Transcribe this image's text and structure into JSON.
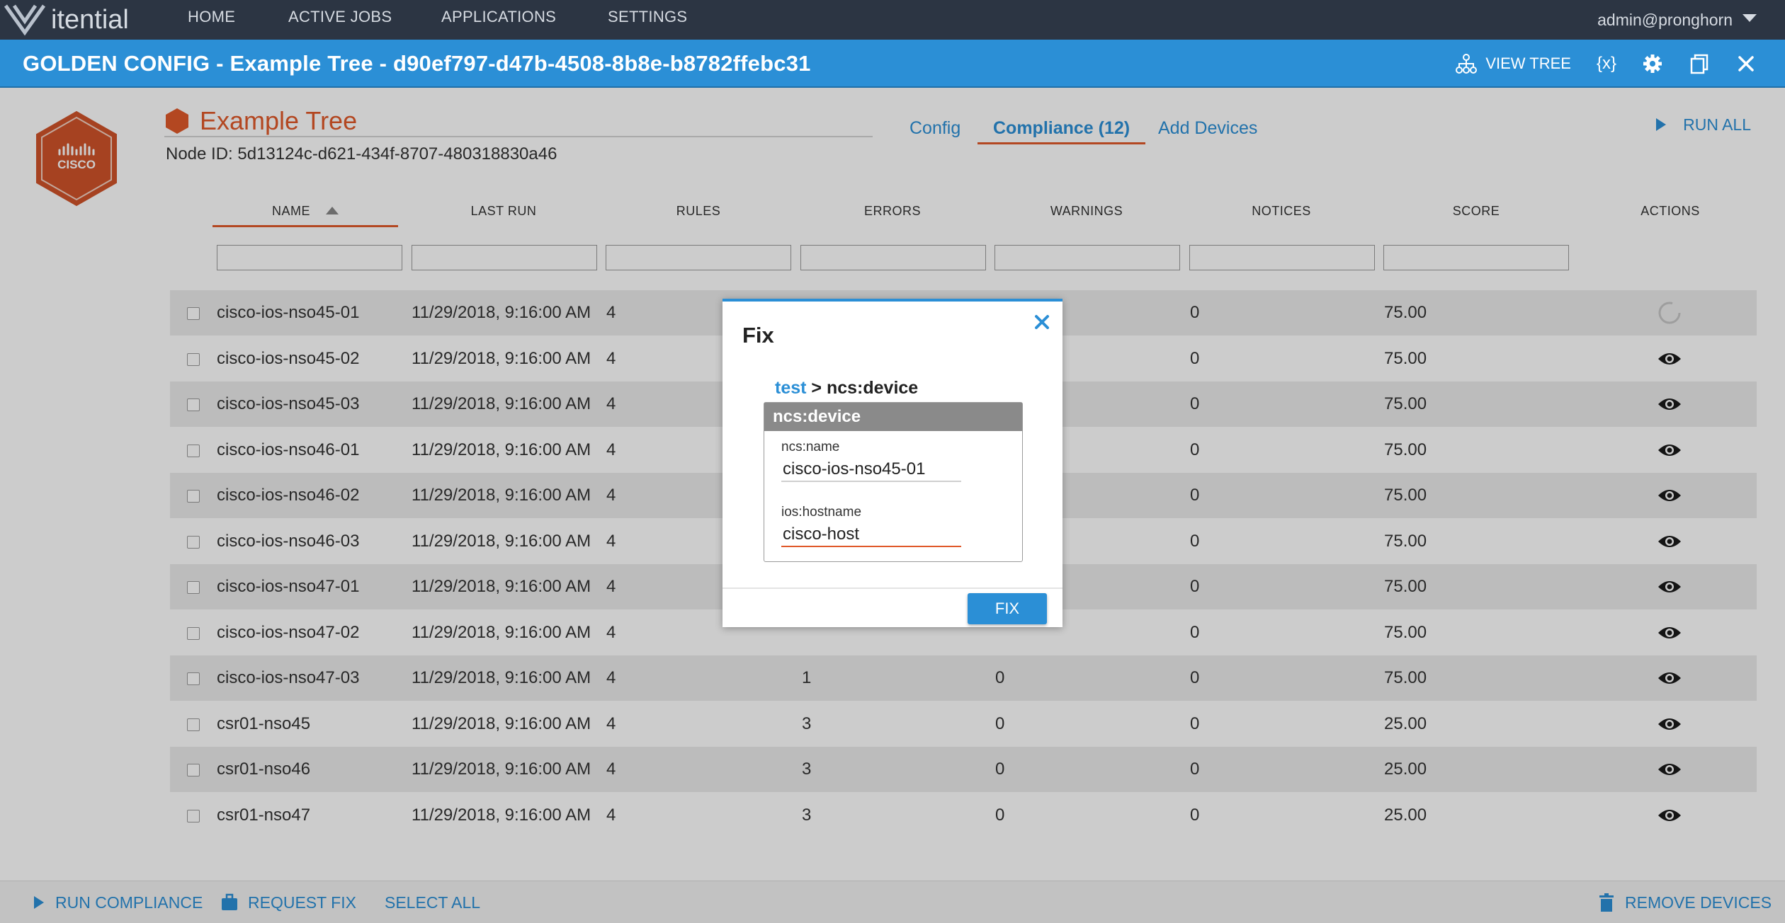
{
  "nav": {
    "brand": "itential",
    "items": [
      "HOME",
      "ACTIVE JOBS",
      "APPLICATIONS",
      "SETTINGS"
    ],
    "user": "admin@pronghorn"
  },
  "titlebar": {
    "title": "GOLDEN CONFIG - Example Tree - d90ef797-d47b-4508-8b8e-b8782ffebc31",
    "view_tree": "VIEW TREE",
    "variables": "{x}"
  },
  "node": {
    "logo_text": "CISCO",
    "name": "Example Tree",
    "id_label": "Node ID: 5d13124c-d621-434f-8707-480318830a46"
  },
  "tabs": [
    {
      "label": "Config",
      "active": false
    },
    {
      "label": "Compliance (12)",
      "active": true
    },
    {
      "label": "Add Devices",
      "active": false
    }
  ],
  "run_all": "RUN ALL",
  "table": {
    "columns": [
      "NAME",
      "LAST RUN",
      "RULES",
      "ERRORS",
      "WARNINGS",
      "NOTICES",
      "SCORE",
      "ACTIONS"
    ],
    "rows": [
      {
        "name": "cisco-ios-nso45-01",
        "last_run": "11/29/2018, 9:16:00 AM",
        "rules": "4",
        "errors": "",
        "warnings": "",
        "notices": "0",
        "score": "75.00",
        "action": "spinner"
      },
      {
        "name": "cisco-ios-nso45-02",
        "last_run": "11/29/2018, 9:16:00 AM",
        "rules": "4",
        "errors": "",
        "warnings": "",
        "notices": "0",
        "score": "75.00",
        "action": "eye"
      },
      {
        "name": "cisco-ios-nso45-03",
        "last_run": "11/29/2018, 9:16:00 AM",
        "rules": "4",
        "errors": "",
        "warnings": "",
        "notices": "0",
        "score": "75.00",
        "action": "eye"
      },
      {
        "name": "cisco-ios-nso46-01",
        "last_run": "11/29/2018, 9:16:00 AM",
        "rules": "4",
        "errors": "",
        "warnings": "",
        "notices": "0",
        "score": "75.00",
        "action": "eye"
      },
      {
        "name": "cisco-ios-nso46-02",
        "last_run": "11/29/2018, 9:16:00 AM",
        "rules": "4",
        "errors": "",
        "warnings": "",
        "notices": "0",
        "score": "75.00",
        "action": "eye"
      },
      {
        "name": "cisco-ios-nso46-03",
        "last_run": "11/29/2018, 9:16:00 AM",
        "rules": "4",
        "errors": "",
        "warnings": "",
        "notices": "0",
        "score": "75.00",
        "action": "eye"
      },
      {
        "name": "cisco-ios-nso47-01",
        "last_run": "11/29/2018, 9:16:00 AM",
        "rules": "4",
        "errors": "",
        "warnings": "",
        "notices": "0",
        "score": "75.00",
        "action": "eye"
      },
      {
        "name": "cisco-ios-nso47-02",
        "last_run": "11/29/2018, 9:16:00 AM",
        "rules": "4",
        "errors": "",
        "warnings": "",
        "notices": "0",
        "score": "75.00",
        "action": "eye"
      },
      {
        "name": "cisco-ios-nso47-03",
        "last_run": "11/29/2018, 9:16:00 AM",
        "rules": "4",
        "errors": "1",
        "warnings": "0",
        "notices": "0",
        "score": "75.00",
        "action": "eye"
      },
      {
        "name": "csr01-nso45",
        "last_run": "11/29/2018, 9:16:00 AM",
        "rules": "4",
        "errors": "3",
        "warnings": "0",
        "notices": "0",
        "score": "25.00",
        "action": "eye"
      },
      {
        "name": "csr01-nso46",
        "last_run": "11/29/2018, 9:16:00 AM",
        "rules": "4",
        "errors": "3",
        "warnings": "0",
        "notices": "0",
        "score": "25.00",
        "action": "eye"
      },
      {
        "name": "csr01-nso47",
        "last_run": "11/29/2018, 9:16:00 AM",
        "rules": "4",
        "errors": "3",
        "warnings": "0",
        "notices": "0",
        "score": "25.00",
        "action": "eye"
      }
    ]
  },
  "bottombar": {
    "run_compliance": "RUN COMPLIANCE",
    "request_fix": "REQUEST FIX",
    "select_all": "SELECT ALL",
    "remove_devices": "REMOVE DEVICES"
  },
  "modal": {
    "title": "Fix",
    "crumb_link": "test",
    "crumb_sep": " > ",
    "crumb_current": "ncs:device",
    "group_title": "ncs:device",
    "fields": [
      {
        "label": "ncs:name",
        "value": "cisco-ios-nso45-01"
      },
      {
        "label": "ios:hostname",
        "value": "cisco-host"
      }
    ],
    "fix_label": "FIX"
  },
  "colors": {
    "nav_bg": "#2c3543",
    "accent_blue": "#2b8fd6",
    "accent_orange": "#e0592a"
  }
}
